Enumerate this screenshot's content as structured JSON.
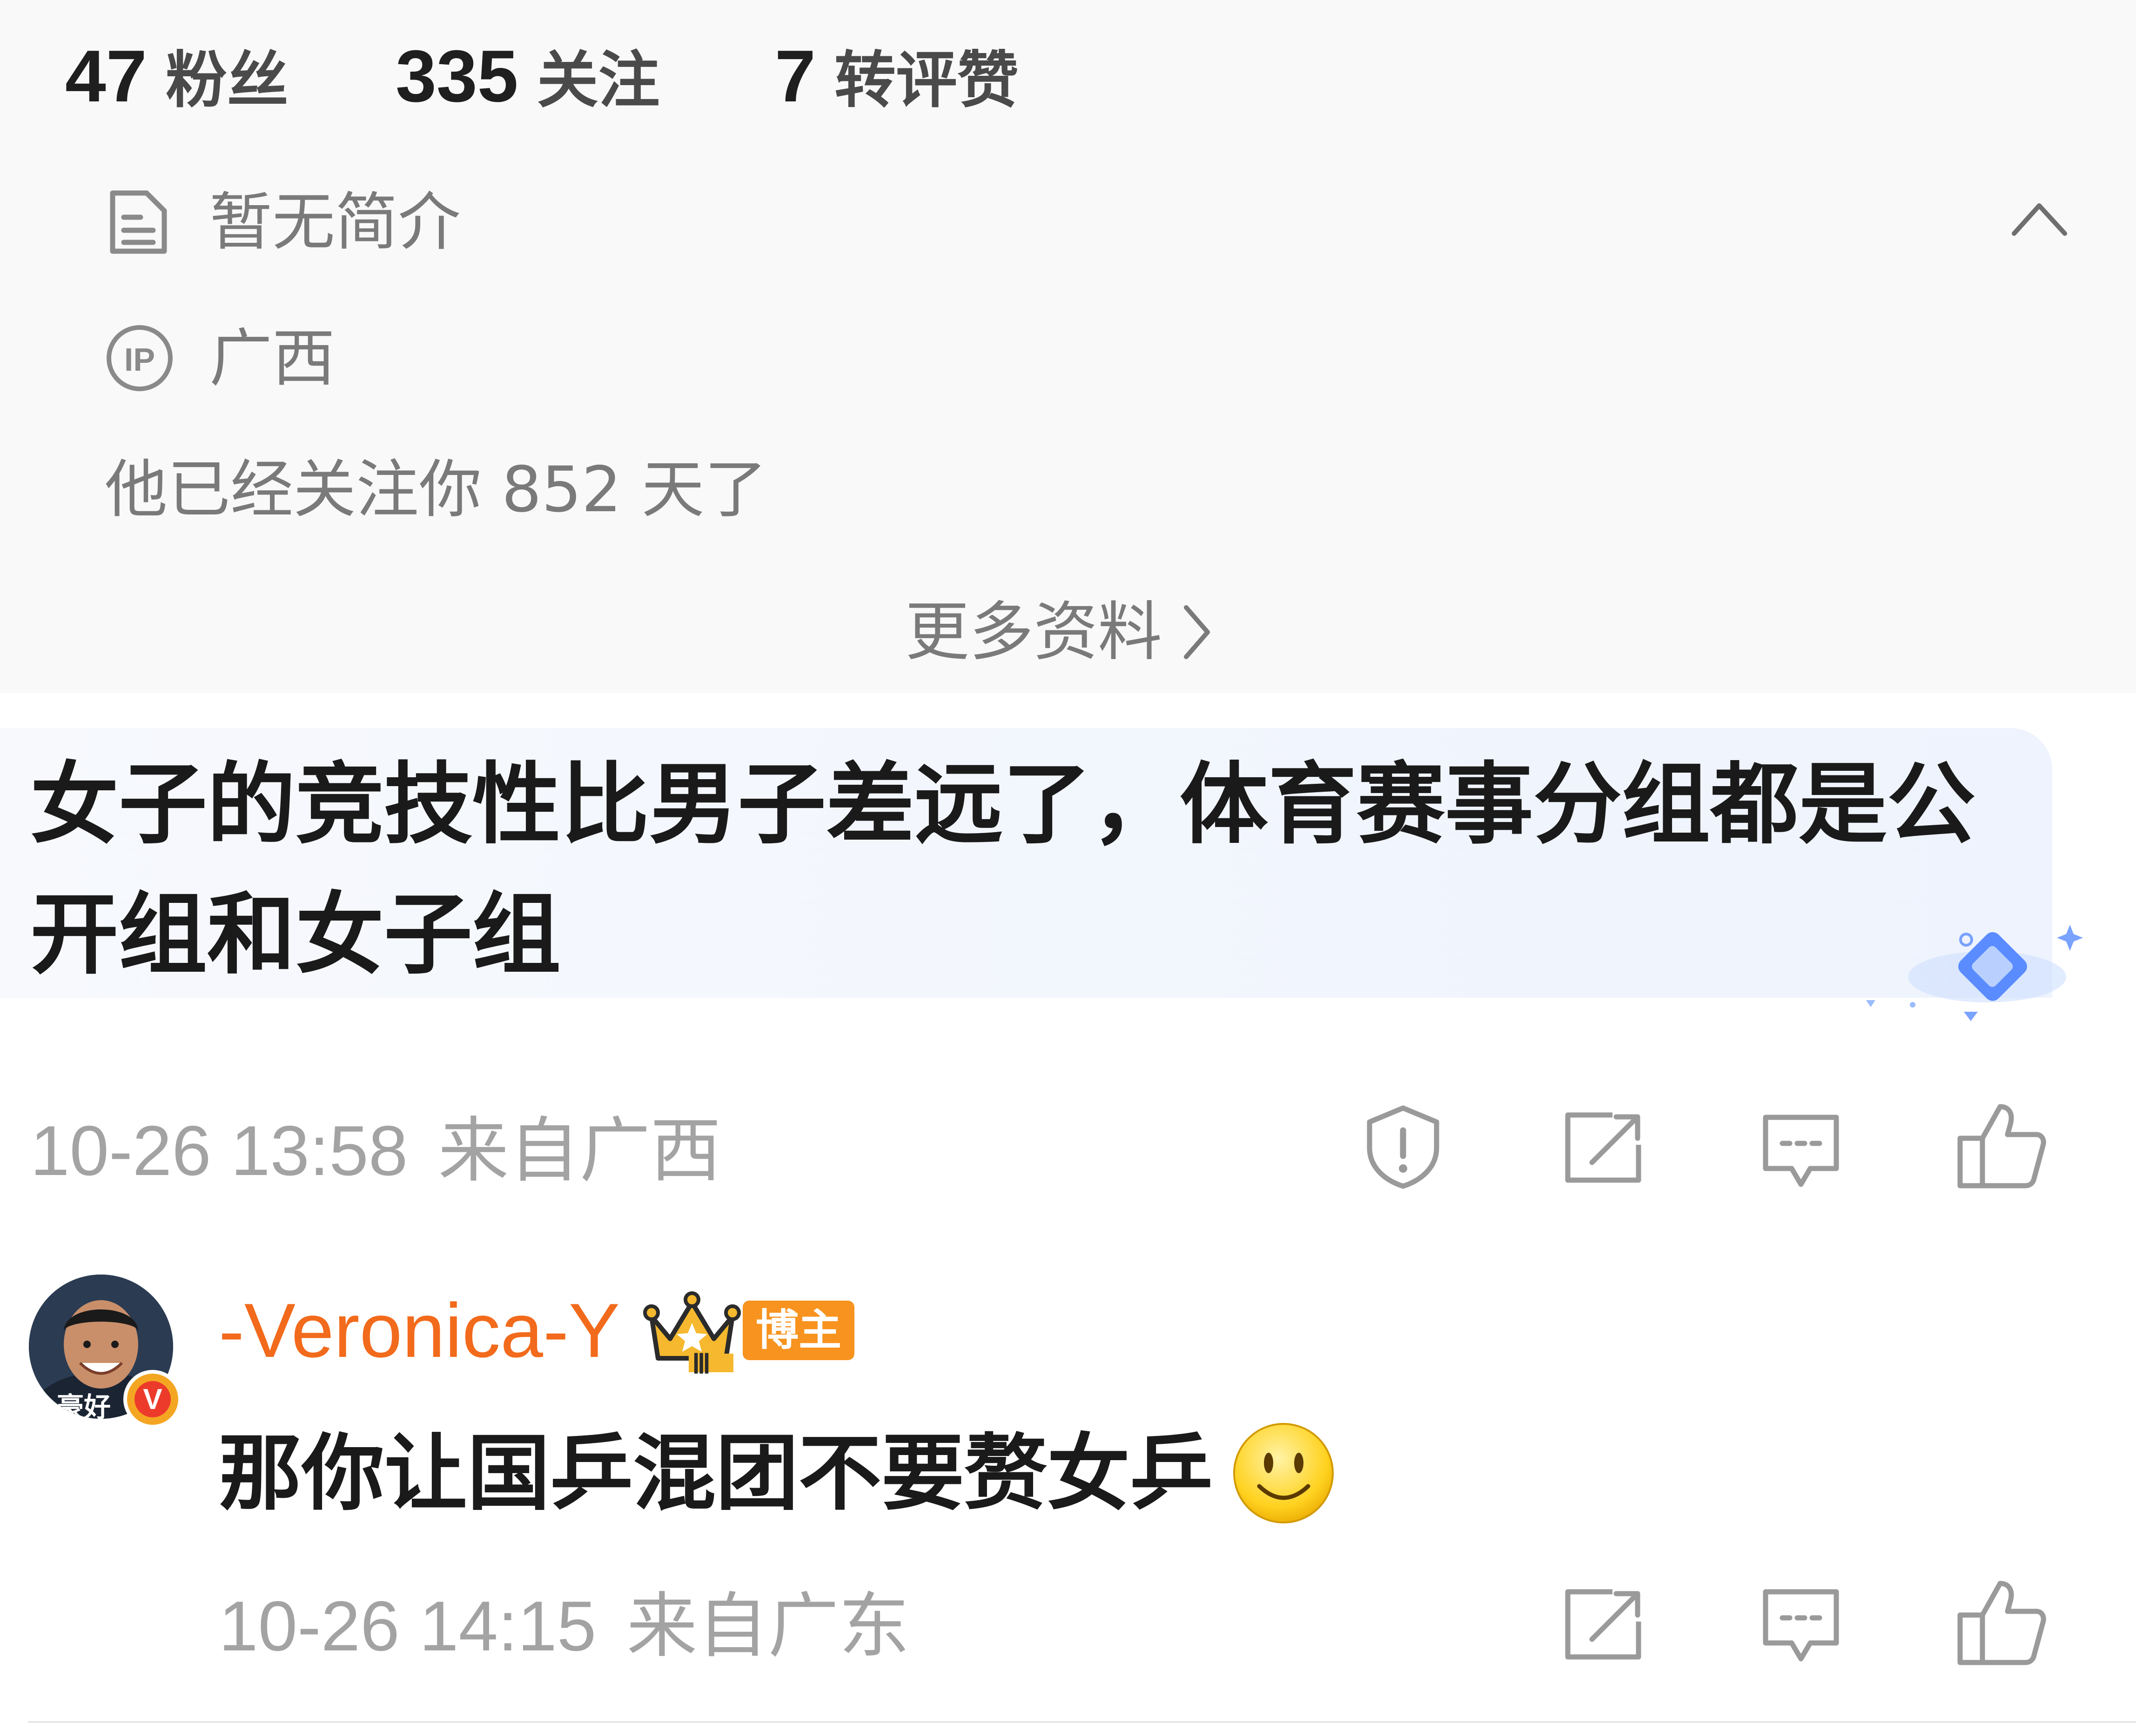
{
  "stats": [
    {
      "count": "47",
      "label": "粉丝"
    },
    {
      "count": "335",
      "label": "关注"
    },
    {
      "count": "7",
      "label": "转评赞"
    }
  ],
  "profile": {
    "bio": "暂无简介",
    "ip_location": "广西",
    "follow_duration": "他已经关注你 852 天了",
    "more_info": "更多资料",
    "icons": {
      "bio": "document-icon",
      "ip": "ip-icon",
      "collapse": "chevron-up-icon",
      "more": "chevron-right-icon"
    }
  },
  "comment": {
    "line1": "女子的竞技性比男子差远了，体育赛事分组都是公",
    "line2": "开组和女子组",
    "timestamp": "10-26 13:58",
    "source": "来自广西",
    "highlight_color": "#eef3fd",
    "actions": [
      "report-icon",
      "repost-icon",
      "comment-icon",
      "like-icon"
    ]
  },
  "reply": {
    "username": "-Veronica-Y",
    "avatar_caption": "豪好",
    "verified_mark": "V",
    "fan_level": "Ⅲ",
    "badge": "博主",
    "text": "那你让国乒混团不要赘女乒",
    "emoji": "smile-emoji",
    "timestamp": "10-26 14:15",
    "source": "来自广东",
    "username_color": "#f26a1b",
    "badge_color": "#f7931e",
    "actions": [
      "repost-icon",
      "comment-icon",
      "like-icon"
    ]
  }
}
